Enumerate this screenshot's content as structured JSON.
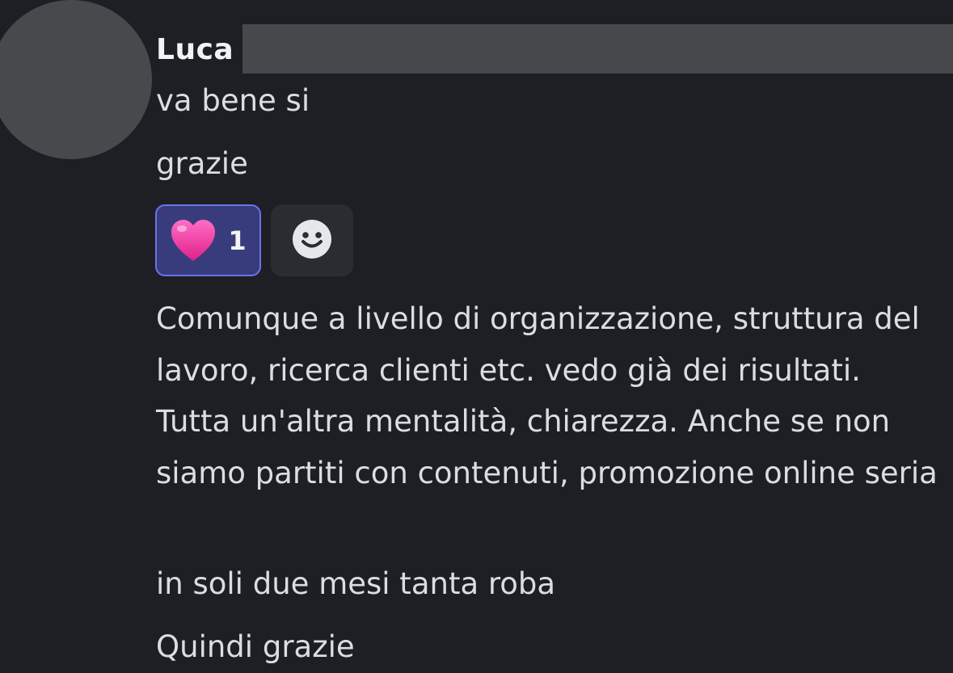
{
  "message": {
    "author": "Luca",
    "lines": [
      "va bene si",
      "grazie"
    ],
    "reaction": {
      "emoji_icon": "pink-heart-icon",
      "count": "1"
    },
    "add_reaction_icon": "smiley-face-icon",
    "long_text": "Comunque a livello di organizzazione, struttura del lavoro, ricerca clienti etc. vedo già dei risultati. Tutta un'altra mentalità, chiarezza. Anche se non siamo partiti con contenuti, promozione online seria",
    "followups": [
      "in soli due mesi tanta roba",
      "Quindi grazie"
    ]
  },
  "colors": {
    "background": "#1e1f24",
    "reaction_bg": "#383c7d",
    "reaction_border": "#6b72ea",
    "heart": "#f0449c"
  }
}
